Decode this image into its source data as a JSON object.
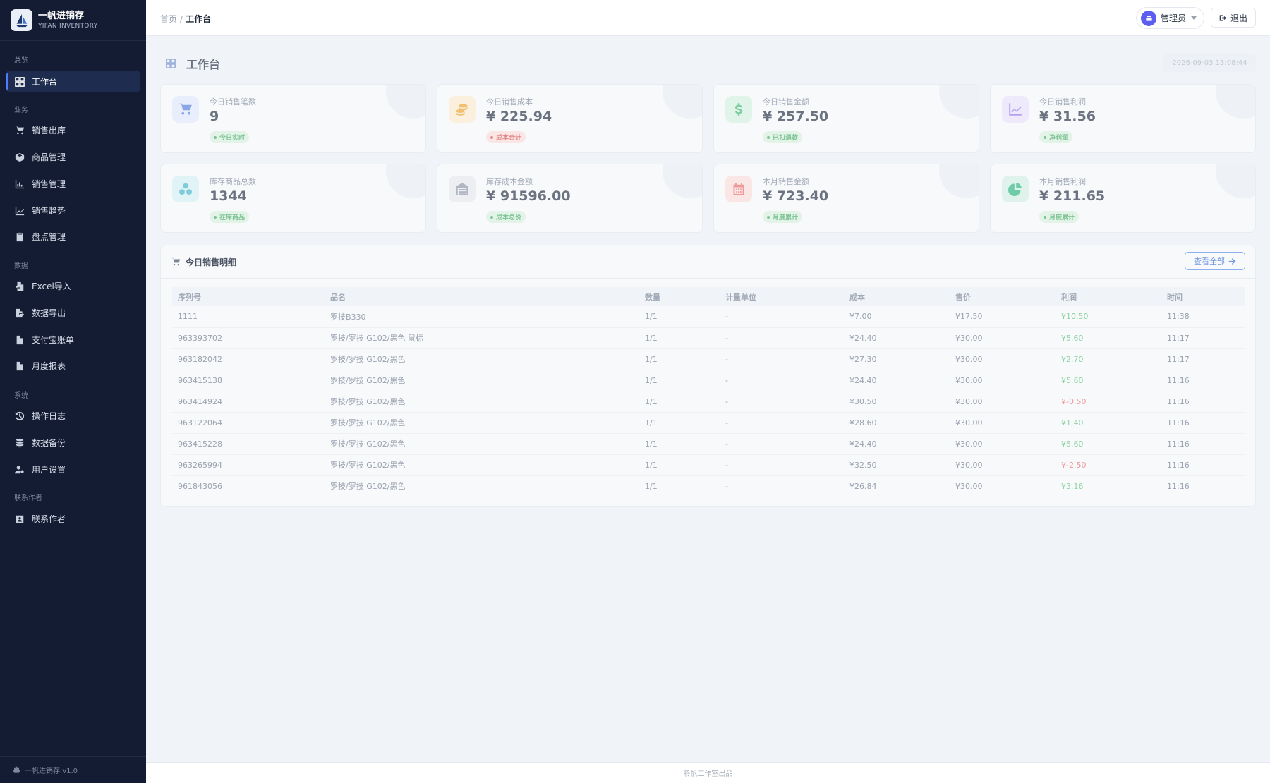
{
  "brand": {
    "name": "一帆进销存",
    "subtitle": "YIFAN INVENTORY"
  },
  "sidebar": {
    "sections": [
      {
        "title": "总览",
        "items": [
          {
            "label": "工作台",
            "icon": "dashboard-icon",
            "active": true
          }
        ]
      },
      {
        "title": "业务",
        "items": [
          {
            "label": "销售出库",
            "icon": "cart-icon"
          },
          {
            "label": "商品管理",
            "icon": "box-icon"
          },
          {
            "label": "销售管理",
            "icon": "bar-chart-icon"
          },
          {
            "label": "销售趋势",
            "icon": "line-chart-icon"
          },
          {
            "label": "盘点管理",
            "icon": "clipboard-icon"
          }
        ]
      },
      {
        "title": "数据",
        "items": [
          {
            "label": "Excel导入",
            "icon": "file-import-icon"
          },
          {
            "label": "数据导出",
            "icon": "file-export-icon"
          },
          {
            "label": "支付宝账单",
            "icon": "file-icon"
          },
          {
            "label": "月度报表",
            "icon": "report-icon"
          }
        ]
      },
      {
        "title": "系统",
        "items": [
          {
            "label": "操作日志",
            "icon": "history-icon"
          },
          {
            "label": "数据备份",
            "icon": "database-icon"
          },
          {
            "label": "用户设置",
            "icon": "user-gear-icon"
          }
        ]
      },
      {
        "title": "联系作者",
        "items": [
          {
            "label": "联系作者",
            "icon": "contact-icon"
          }
        ]
      }
    ],
    "footer": "一帆进销存 v1.0"
  },
  "header": {
    "breadcrumb_home": "首页",
    "breadcrumb_sep": "/",
    "breadcrumb_current": "工作台",
    "user_label": "管理员",
    "logout_label": "退出"
  },
  "page": {
    "title": "工作台",
    "datetime": "2026-09-03 13:08:44"
  },
  "colors": {
    "sidebar_bg": "#131c33",
    "accent": "#4f7cff",
    "profit_positive": "#8fd3a4",
    "profit_negative": "#ef9a9a"
  },
  "cards": [
    {
      "label": "今日销售笔数",
      "value": "9",
      "tag": "今日实时",
      "icon": "cart-icon",
      "tone": "blue"
    },
    {
      "label": "今日销售成本",
      "value": "¥ 225.94",
      "tag": "成本合计",
      "icon": "coins-icon",
      "tone": "orange"
    },
    {
      "label": "今日销售金额",
      "value": "¥ 257.50",
      "tag": "已扣退款",
      "icon": "dollar-icon",
      "tone": "green"
    },
    {
      "label": "今日销售利润",
      "value": "¥ 31.56",
      "tag": "净利润",
      "icon": "trend-icon",
      "tone": "purple"
    },
    {
      "label": "库存商品总数",
      "value": "1344",
      "tag": "在库商品",
      "icon": "cubes-icon",
      "tone": "cyan"
    },
    {
      "label": "库存成本金额",
      "value": "¥ 91596.00",
      "tag": "成本总价",
      "icon": "warehouse-icon",
      "tone": "gray"
    },
    {
      "label": "本月销售金额",
      "value": "¥ 723.40",
      "tag": "月度累计",
      "icon": "calendar-icon",
      "tone": "red"
    },
    {
      "label": "本月销售利润",
      "value": "¥ 211.65",
      "tag": "月度累计",
      "icon": "pie-icon",
      "tone": "teal"
    }
  ],
  "sales": {
    "title": "今日销售明细",
    "view_all": "查看全部",
    "columns": [
      "序列号",
      "品名",
      "数量",
      "计量单位",
      "成本",
      "售价",
      "利润",
      "时间"
    ],
    "rows": [
      [
        "1111",
        "罗技B330",
        "1/1",
        "-",
        "¥7.00",
        "¥17.50",
        "¥10.50",
        "11:38"
      ],
      [
        "963393702",
        "罗技/罗技 G102/黑色 鼠标",
        "1/1",
        "-",
        "¥24.40",
        "¥30.00",
        "¥5.60",
        "11:17"
      ],
      [
        "963182042",
        "罗技/罗技 G102/黑色",
        "1/1",
        "-",
        "¥27.30",
        "¥30.00",
        "¥2.70",
        "11:17"
      ],
      [
        "963415138",
        "罗技/罗技 G102/黑色",
        "1/1",
        "-",
        "¥24.40",
        "¥30.00",
        "¥5.60",
        "11:16"
      ],
      [
        "963414924",
        "罗技/罗技 G102/黑色",
        "1/1",
        "-",
        "¥30.50",
        "¥30.00",
        "¥-0.50",
        "11:16"
      ],
      [
        "963122064",
        "罗技/罗技 G102/黑色",
        "1/1",
        "-",
        "¥28.60",
        "¥30.00",
        "¥1.40",
        "11:16"
      ],
      [
        "963415228",
        "罗技/罗技 G102/黑色",
        "1/1",
        "-",
        "¥24.40",
        "¥30.00",
        "¥5.60",
        "11:16"
      ],
      [
        "963265994",
        "罗技/罗技 G102/黑色",
        "1/1",
        "-",
        "¥32.50",
        "¥30.00",
        "¥-2.50",
        "11:16"
      ],
      [
        "961843056",
        "罗技/罗技 G102/黑色",
        "1/1",
        "-",
        "¥26.84",
        "¥30.00",
        "¥3.16",
        "11:16"
      ]
    ]
  },
  "footer": "聆帆工作室出品"
}
